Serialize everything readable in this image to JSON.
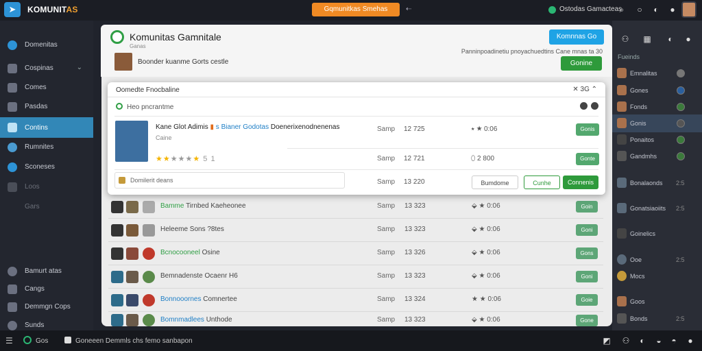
{
  "topbar": {
    "title_main": "KOMUNIT",
    "title_accent": "AS",
    "search_label": "Gqmunitkas Smehas",
    "back_arrow": "⇠",
    "status_text": "Ostodas Gamacteas",
    "icons": [
      "search-icon",
      "circle-icon",
      "mask-icon",
      "settings-icon"
    ]
  },
  "sidebar": {
    "items": [
      {
        "label": "Domenitas",
        "icon": "globe-icon"
      },
      {
        "label": "Cospinas",
        "icon": "grid-icon",
        "chevron": "⌄"
      },
      {
        "label": "Comes",
        "icon": "gamepad-icon"
      },
      {
        "label": "Pasdas",
        "icon": "folder-icon"
      },
      {
        "label": "Contins",
        "icon": "chat-icon"
      },
      {
        "label": "Rumnites",
        "icon": "game-icon"
      },
      {
        "label": "Sconeses",
        "icon": "steam-icon"
      },
      {
        "label": "Loos",
        "icon": "tools-icon"
      },
      {
        "label": "Gars",
        "icon": "none"
      }
    ],
    "bottom_items": [
      {
        "label": "Bamurt atas",
        "icon": "world-icon"
      },
      {
        "label": "Cangs",
        "icon": "grid-icon"
      },
      {
        "label": "Demmgn Cops",
        "icon": "user-icon"
      },
      {
        "label": "Sunds",
        "icon": "help-icon"
      }
    ]
  },
  "modal": {
    "title": "Komunitas Gamnitale",
    "subtitle": "Ganas",
    "description": "Boonder kuanme Gorts cestle",
    "blue_button": "Komnnas Go",
    "note": "Panninpoadinetiu pnoyachuedtins Cane mnas ta 30",
    "green_button": "Gonine"
  },
  "card": {
    "title": "Oomedte Fnocbaline",
    "close": "✕ 3G ⌃",
    "subtitle": "Heo pncrantme",
    "game": {
      "name_a": "Kane Glot Adimis",
      "name_b": "s Bianer Godotas",
      "name_c": "Doenerixenodnenenas",
      "category": "Caine",
      "rating_text": "5 1"
    },
    "rows": [
      {
        "sm": "Samp",
        "tm": "12 725",
        "rt": "⭑ ★ 0:06",
        "btn": "Gonis"
      },
      {
        "sm": "Samp",
        "tm": "12 721",
        "rt": "⬯ 2 800",
        "btn": "Gonte"
      }
    ],
    "input_placeholder": "Domilerit deans",
    "input_row": {
      "sm": "Samp",
      "tm": "13 220",
      "rt": "Bumdome"
    },
    "action_outline": "Cunhe",
    "action_primary": "Connenis"
  },
  "bg_rows": [
    {
      "name_a": "Bamme",
      "name_b": "Tirnbed Kaeheonee",
      "sm": "Samp",
      "tm": "13 323",
      "rt": "⬙ ★ 0:06",
      "btn": "Goin"
    },
    {
      "name_a": "",
      "name_b": "Heleeme Sons ?8tes",
      "sm": "Samp",
      "tm": "13 323",
      "rt": "⬙ ★ 0:06",
      "btn": "Goni"
    },
    {
      "name_a": "Bcnocooneel",
      "name_b": "Osine",
      "sm": "Samp",
      "tm": "13 326",
      "rt": "⬙ ★ 0:06",
      "btn": "Gons"
    },
    {
      "name_a": "",
      "name_b": "Bemnadenste Ocaenr H6",
      "sm": "Samp",
      "tm": "13 323",
      "rt": "⬙ ★ 0:06",
      "btn": "Goni"
    },
    {
      "name_a": "Bonnooornes",
      "name_b": "Comnertee",
      "sm": "Samp",
      "tm": "13 324",
      "rt": "★ ★ 0:06",
      "btn": "Goie"
    },
    {
      "name_a": "Bomnmadlees",
      "name_b": "Unthode",
      "sm": "Samp",
      "tm": "13 323",
      "rt": "⬙ ★ 0:06",
      "btn": "Gone"
    }
  ],
  "right_panel": {
    "header": "Fueinds",
    "friends": [
      {
        "name": "Emnalitas"
      },
      {
        "name": "Gones"
      },
      {
        "name": "Fonds"
      },
      {
        "name": "Gonis"
      },
      {
        "name": "Ponaitos"
      },
      {
        "name": "Gandmhs"
      },
      {
        "name": "Bonalaonds",
        "num": "2:5"
      },
      {
        "name": "Gonatsiaoiits",
        "num": "2:5"
      },
      {
        "name": "Goinelics"
      },
      {
        "name": "Ooe",
        "num": "2:5"
      },
      {
        "name": "Mocs"
      },
      {
        "name": "Goos"
      },
      {
        "name": "Bonds",
        "num": "2:5"
      }
    ]
  },
  "bottombar": {
    "status": "Gos",
    "message": "Goneeen Demmls chs femo sanbapon"
  },
  "colors": {
    "accent_blue": "#3287b7",
    "orange": "#f08a24",
    "green": "#2e9a3b"
  }
}
